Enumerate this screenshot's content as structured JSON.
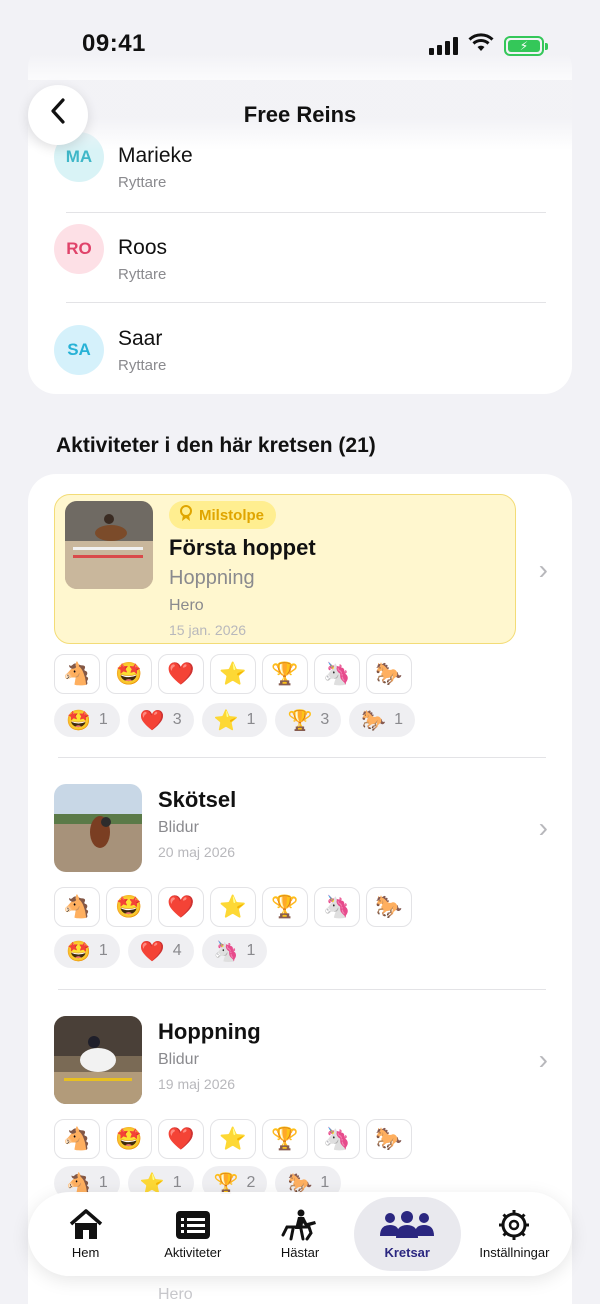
{
  "status": {
    "time": "09:41"
  },
  "nav": {
    "title": "Free Reins",
    "back_icon": "chevron-left-icon"
  },
  "members": [
    {
      "initials": "MA",
      "name": "Marieke",
      "role": "Ryttare",
      "bg": "#d9f3f6",
      "fg": "#3fb7c8"
    },
    {
      "initials": "RO",
      "name": "Roos",
      "role": "Ryttare",
      "bg": "#fde0e6",
      "fg": "#e0436a"
    },
    {
      "initials": "SA",
      "name": "Saar",
      "role": "Ryttare",
      "bg": "#d5f1fb",
      "fg": "#27b2d6"
    }
  ],
  "activities_section": {
    "title": "Aktiviteter i den här kretsen (21)"
  },
  "reactions_available": [
    "🐴",
    "🤩",
    "❤️",
    "⭐",
    "🏆",
    "🦄",
    "🐎"
  ],
  "activities": [
    {
      "badge": "Milstolpe",
      "title": "Första hoppet",
      "type": "Hoppning",
      "horse": "Hero",
      "date": "15 jan. 2026",
      "counts": [
        {
          "emoji": "🤩",
          "n": "1"
        },
        {
          "emoji": "❤️",
          "n": "3"
        },
        {
          "emoji": "⭐",
          "n": "1"
        },
        {
          "emoji": "🏆",
          "n": "3"
        },
        {
          "emoji": "🐎",
          "n": "1"
        }
      ]
    },
    {
      "title": "Skötsel",
      "horse": "Blidur",
      "date": "20 maj 2026",
      "counts": [
        {
          "emoji": "🤩",
          "n": "1"
        },
        {
          "emoji": "❤️",
          "n": "4"
        },
        {
          "emoji": "🦄",
          "n": "1"
        }
      ]
    },
    {
      "title": "Hoppning",
      "horse": "Blidur",
      "date": "19 maj 2026",
      "counts": [
        {
          "emoji": "🐴",
          "n": "1"
        },
        {
          "emoji": "⭐",
          "n": "1"
        },
        {
          "emoji": "🏆",
          "n": "2"
        },
        {
          "emoji": "🐎",
          "n": "1"
        }
      ]
    }
  ],
  "next_activity_horse": "Hero",
  "tabbar": {
    "items": [
      {
        "label": "Hem",
        "icon": "home-icon"
      },
      {
        "label": "Aktiviteter",
        "icon": "list-icon"
      },
      {
        "label": "Hästar",
        "icon": "horse-rider-icon"
      },
      {
        "label": "Kretsar",
        "icon": "people-icon",
        "active": true
      },
      {
        "label": "Inställningar",
        "icon": "gear-icon"
      }
    ]
  }
}
